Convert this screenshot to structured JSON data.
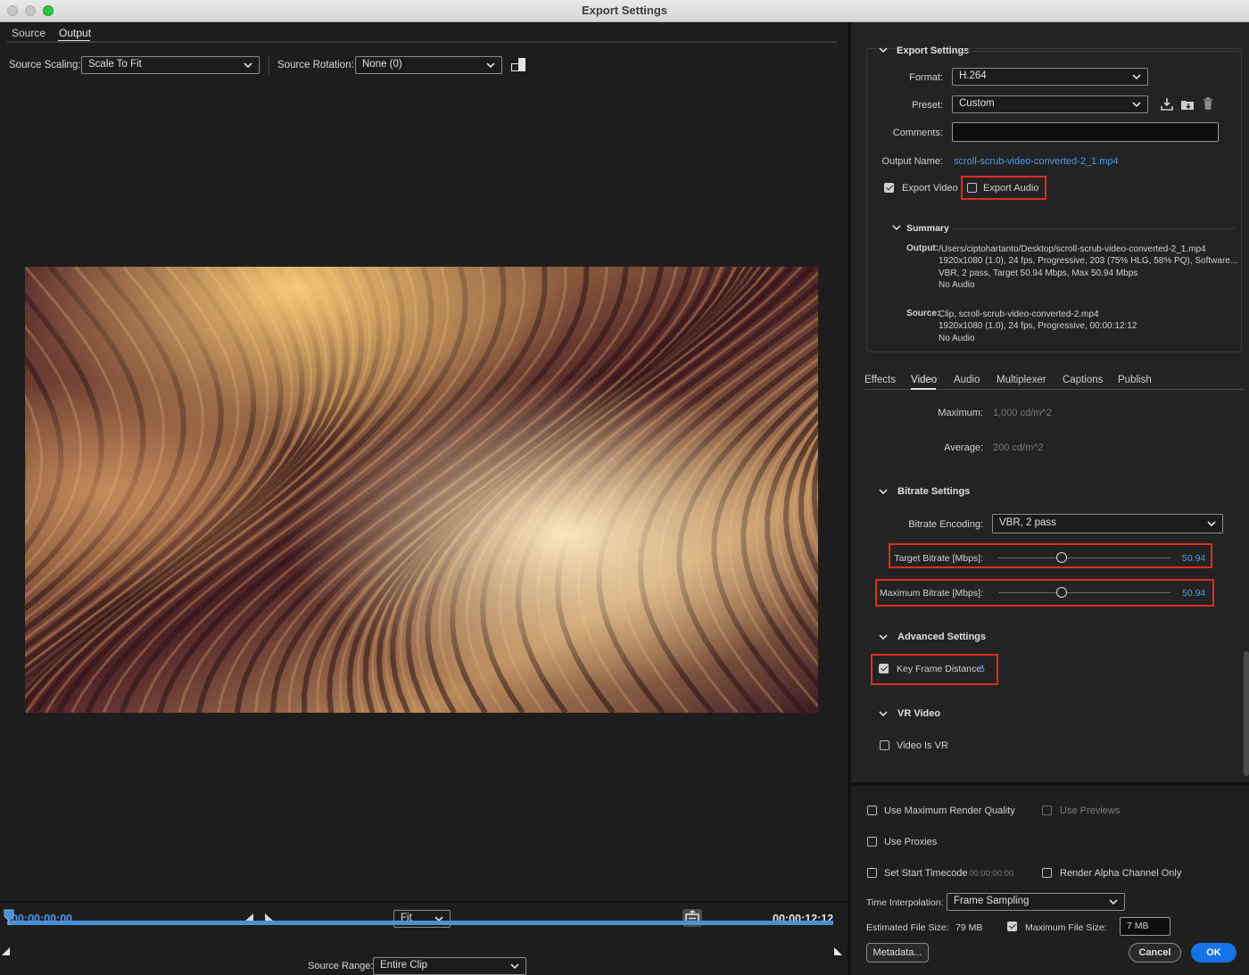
{
  "window": {
    "title": "Export Settings"
  },
  "left": {
    "tabs": [
      {
        "label": "Source"
      },
      {
        "label": "Output"
      }
    ],
    "source_scaling": {
      "label": "Source Scaling:",
      "value": "Scale To Fit"
    },
    "source_rotation": {
      "label": "Source Rotation:",
      "value": "None (0)"
    },
    "timeline": {
      "current_time": "00:00:00:00",
      "end_time": "00:00:12:12",
      "zoom": "Fit",
      "source_range_label": "Source Range:",
      "source_range_value": "Entire Clip",
      "playhead_progress": 0
    }
  },
  "export_settings": {
    "heading": "Export Settings",
    "format": {
      "label": "Format:",
      "value": "H.264"
    },
    "preset": {
      "label": "Preset:",
      "value": "Custom"
    },
    "comments": {
      "label": "Comments:",
      "value": ""
    },
    "output_name": {
      "label": "Output Name:",
      "value": "scroll-scrub-video-converted-2_1.mp4"
    },
    "export_video": {
      "label": "Export Video",
      "checked": true
    },
    "export_audio": {
      "label": "Export Audio",
      "checked": false
    },
    "summary": {
      "heading": "Summary",
      "output_label": "Output:",
      "output_lines": [
        "/Users/ciptohartanto/Desktop/scroll-scrub-video-converted-2_1.mp4",
        "1920x1080 (1.0), 24 fps, Progressive, 203 (75% HLG, 58% PQ), Software...",
        "VBR, 2 pass, Target 50.94 Mbps, Max 50.94 Mbps",
        "No Audio"
      ],
      "source_label": "Source:",
      "source_lines": [
        "Clip, scroll-scrub-video-converted-2.mp4",
        "1920x1080 (1.0), 24 fps, Progressive, 00:00:12:12",
        "No Audio"
      ]
    }
  },
  "settings_tabs": [
    {
      "label": "Effects"
    },
    {
      "label": "Video"
    },
    {
      "label": "Audio"
    },
    {
      "label": "Multiplexer"
    },
    {
      "label": "Captions"
    },
    {
      "label": "Publish"
    }
  ],
  "video": {
    "maximum": {
      "label": "Maximum:",
      "value": "1,000 cd/m^2"
    },
    "average": {
      "label": "Average:",
      "value": "200 cd/m^2"
    },
    "bitrate_settings": {
      "heading": "Bitrate Settings",
      "encoding": {
        "label": "Bitrate Encoding:",
        "value": "VBR, 2 pass"
      },
      "target": {
        "label": "Target Bitrate [Mbps]:",
        "value": "50.94"
      },
      "maximum": {
        "label": "Maximum Bitrate [Mbps]:",
        "value": "50.94"
      }
    },
    "advanced_settings": {
      "heading": "Advanced Settings",
      "key_frame": {
        "label": "Key Frame Distance:",
        "value": "5",
        "checked": true
      }
    },
    "vr_video": {
      "heading": "VR Video",
      "video_is_vr": {
        "label": "Video Is VR",
        "checked": false
      }
    }
  },
  "bottom": {
    "max_render_quality": {
      "label": "Use Maximum Render Quality",
      "checked": false
    },
    "use_previews": {
      "label": "Use Previews",
      "checked": false
    },
    "use_proxies": {
      "label": "Use Proxies",
      "checked": false
    },
    "set_start_timecode": {
      "label": "Set Start Timecode",
      "value": "00:00:00:00",
      "checked": false
    },
    "render_alpha": {
      "label": "Render Alpha Channel Only",
      "checked": false
    },
    "time_interpolation": {
      "label": "Time Interpolation:",
      "value": "Frame Sampling"
    },
    "estimated_size": {
      "label": "Estimated File Size:",
      "value": "79 MB"
    },
    "max_file_size": {
      "label": "Maximum File Size:",
      "value": "7 MB",
      "checked": true
    },
    "metadata_button": "Metadata...",
    "cancel_button": "Cancel",
    "ok_button": "OK"
  }
}
